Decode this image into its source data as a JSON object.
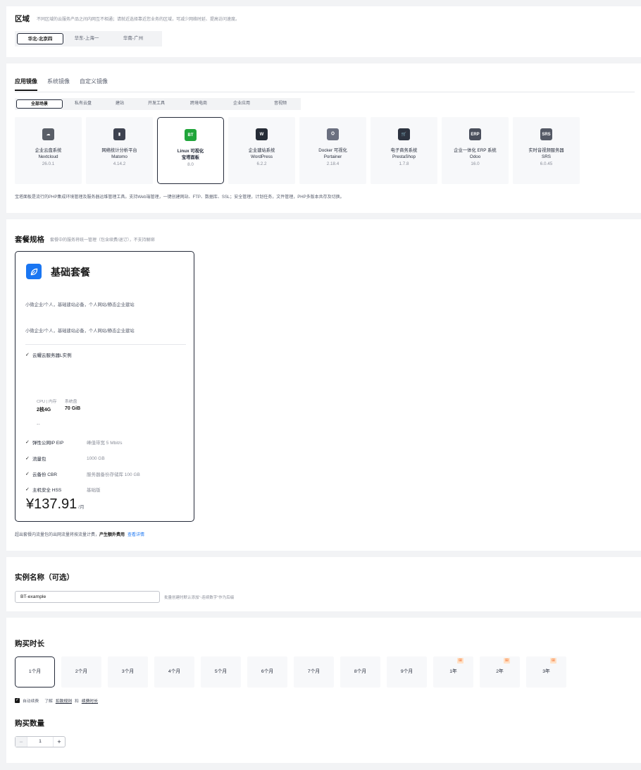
{
  "region": {
    "title": "区域",
    "hint": "不同区域的云服务产品之间内网互不相通；请就近选择靠近您业务的区域，可减少网络时延、提高访问速度。",
    "tabs": [
      "华北-北京四",
      "华东-上海一",
      "华南-广州"
    ]
  },
  "image": {
    "tabs": [
      "应用镜像",
      "系统镜像",
      "自定义镜像"
    ],
    "scenes": [
      "全部场景",
      "私有云盘",
      "建站",
      "开发工具",
      "跨境电商",
      "企业应用",
      "音视频"
    ],
    "cards": [
      {
        "name1": "企业云盘系统",
        "name2": "Nextcloud",
        "version": "26.0.1",
        "icon": "cloud-icon",
        "icon_text": "☁",
        "color": "#5a5f68"
      },
      {
        "name1": "网络统计分析平台",
        "name2": "Matomo",
        "version": "4.14.2",
        "icon": "bar-chart-icon",
        "icon_text": "▮",
        "color": "#3e4350"
      },
      {
        "name1": "Linux 可视化",
        "name2": "宝塔面板",
        "version": "8.0",
        "icon": "bt-icon",
        "icon_text": "BT",
        "color": "#20a53a"
      },
      {
        "name1": "企业建站系统",
        "name2": "WordPress",
        "version": "6.2.2",
        "icon": "wordpress-icon",
        "icon_text": "W",
        "color": "#262c36"
      },
      {
        "name1": "Docker 可视化",
        "name2": "Portainer",
        "version": "2.18.4",
        "icon": "docker-icon",
        "icon_text": "⛭",
        "color": "#6b7080"
      },
      {
        "name1": "电子商务系统",
        "name2": "PrestaShop",
        "version": "1.7.8",
        "icon": "shopping-cart-icon",
        "icon_text": "🛒",
        "color": "#2d3340"
      },
      {
        "name1": "企业一体化 ERP 系统",
        "name2": "Odoo",
        "version": "16.0",
        "icon": "erp-icon",
        "icon_text": "ERP",
        "color": "#4a4f5c"
      },
      {
        "name1": "实时音视频服务器",
        "name2": "SRS",
        "version": "6.0.45",
        "icon": "srs-icon",
        "icon_text": "SRS",
        "color": "#545965"
      }
    ],
    "desc": "宝塔面板是流行的PHP集成环境管理及服务器运维管理工具。支持Web端管理，一键创建网站、FTP、数据库、SSL；安全管理，计划任务，文件管理，PHP多版本共存及切换。"
  },
  "package": {
    "title": "套餐规格",
    "hint": "套餐中的服务将统一管理（包含续费/退订），不支持解绑",
    "name": "基础套餐",
    "desc1": "小微企业/个人，基础建站必备，个人网站/静态企业建站",
    "desc2": "小微企业/个人，基础建站必备，个人网站/静态企业建站",
    "server": "云耀云服务器L实例",
    "spec_labels": [
      "CPU | 内存",
      "系统盘"
    ],
    "spec_values": [
      "2核4G",
      "70 GiB"
    ],
    "spec_dash": "--",
    "features": [
      {
        "label": "弹性公网IP EIP",
        "value": "峰值带宽 5 Mbit/s"
      },
      {
        "label": "流量包",
        "value": "1000 GB"
      },
      {
        "label": "云备份 CBR",
        "value": "服务器备份存储库 100 GB"
      },
      {
        "label": "主机安全 HSS",
        "value": "基础版"
      }
    ],
    "price": "¥137.91",
    "price_unit": "/月",
    "note_pre": "超出套餐内流量包的出网流量将按流量计费，",
    "note_bold": "产生额外费用",
    "note_link": "查看详情"
  },
  "instance": {
    "title": "实例名称（可选）",
    "value": "BT-example",
    "hint": "批量创建时默认添加\"-连续数字\"作为后缀"
  },
  "duration": {
    "title": "购买时长",
    "options": [
      "1个月",
      "2个月",
      "3个月",
      "4个月",
      "5个月",
      "6个月",
      "7个月",
      "8个月",
      "9个月",
      "1年",
      "2年",
      "3年"
    ],
    "auto_renew": "自动续费",
    "learn": "了解",
    "link1": "扣款规则",
    "and": "和",
    "link2": "续费时长"
  },
  "quantity": {
    "title": "购买数量",
    "value": "1",
    "minus": "−",
    "plus": "+"
  }
}
